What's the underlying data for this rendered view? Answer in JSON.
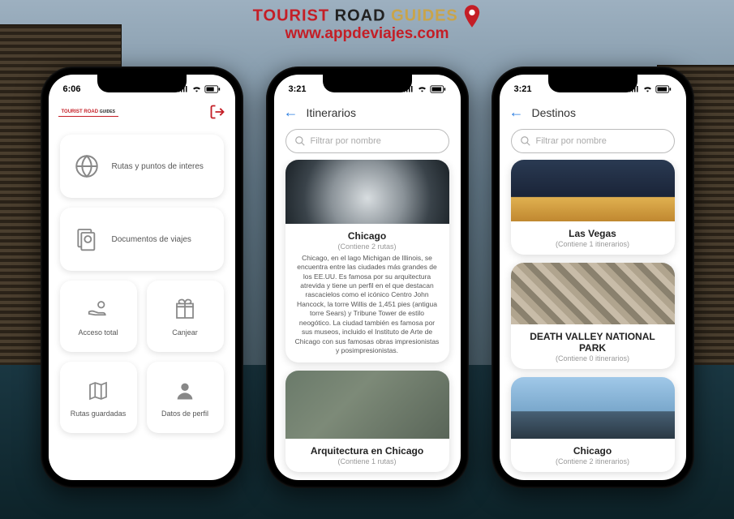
{
  "brand": {
    "tourist": "TOURIST",
    "road": "ROAD",
    "guides": "GUIDES",
    "url": "www.appdeviajes.com"
  },
  "phone1": {
    "time": "6:06",
    "cards": {
      "routes": "Rutas y puntos de interes",
      "docs": "Documentos de viajes",
      "access": "Acceso total",
      "redeem": "Canjear",
      "saved": "Rutas guardadas",
      "profile": "Datos de perfil"
    }
  },
  "phone2": {
    "time": "3:21",
    "title": "Itinerarios",
    "search_placeholder": "Filtrar por nombre",
    "item1": {
      "title": "Chicago",
      "sub": "(Contiene 2 rutas)",
      "desc": "Chicago, en el lago Michigan de Illinois, se encuentra entre las ciudades más grandes de los EE.UU. Es famosa por su arquitectura atrevida y tiene un perfil en el que destacan rascacielos como el icónico Centro John Hancock, la torre Willis de 1,451 pies (antigua torre Sears) y Tribune Tower de estilo neogótico. La ciudad también es famosa por sus museos, incluido el Instituto de Arte de Chicago con sus famosas obras impresionistas y posimpresionistas."
    },
    "item2": {
      "title": "Arquitectura en Chicago",
      "sub": "(Contiene 1 rutas)"
    }
  },
  "phone3": {
    "time": "3:21",
    "title": "Destinos",
    "search_placeholder": "Filtrar por nombre",
    "item1": {
      "title": "Las Vegas",
      "sub": "(Contiene 1 itinerarios)"
    },
    "item2": {
      "title": "DEATH VALLEY NATIONAL PARK",
      "sub": "(Contiene 0 itinerarios)"
    },
    "item3": {
      "title": "Chicago",
      "sub": "(Contiene 2 itinerarios)"
    }
  }
}
